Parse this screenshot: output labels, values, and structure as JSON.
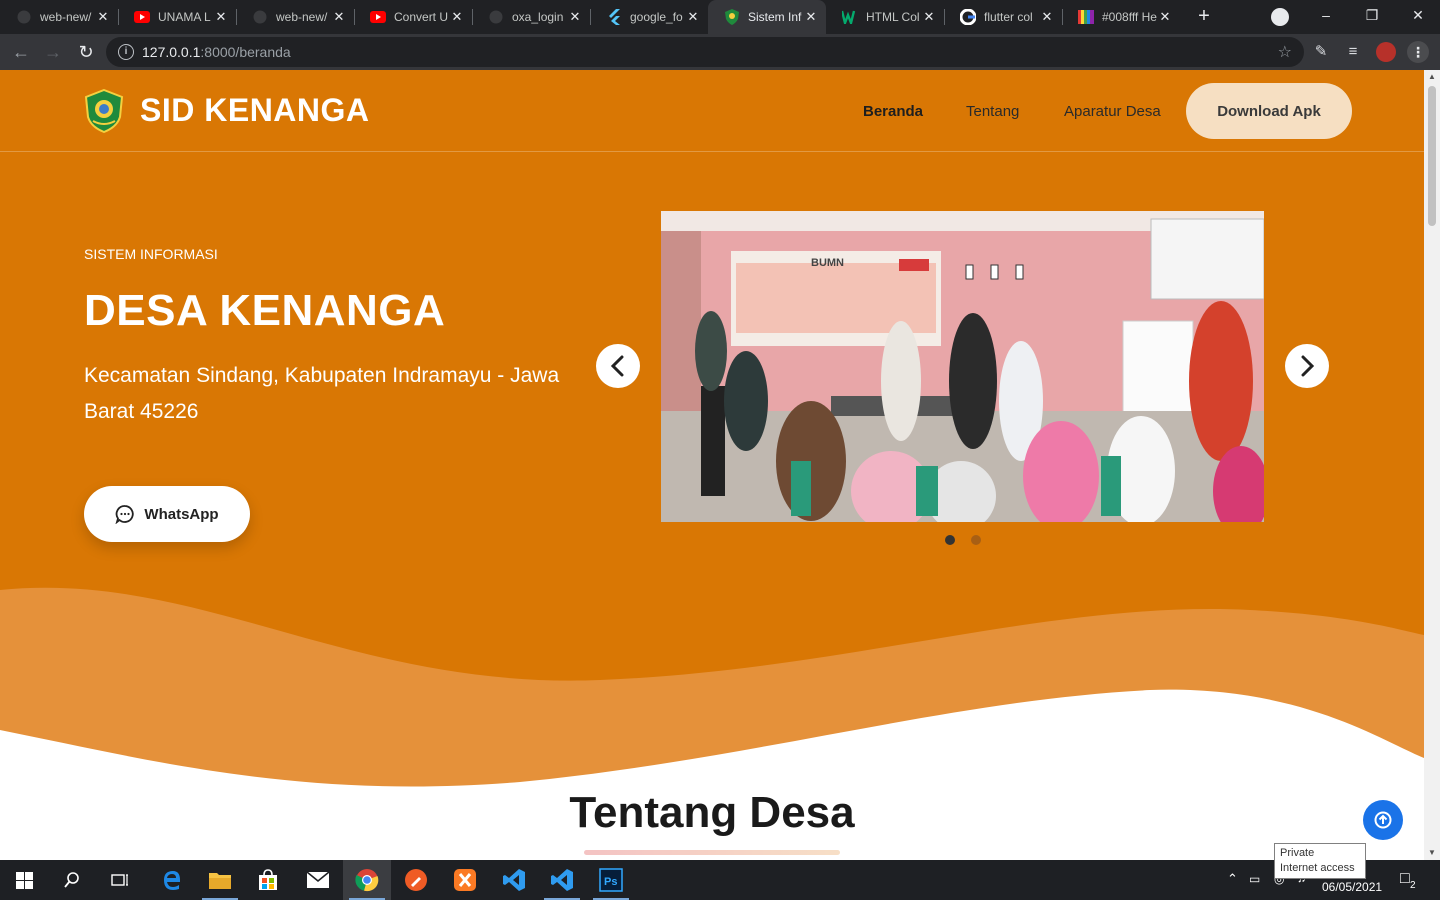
{
  "browser": {
    "tabs": [
      {
        "title": "web-new/",
        "icon": "github-icon"
      },
      {
        "title": "UNAMA L",
        "icon": "youtube-icon"
      },
      {
        "title": "web-new/",
        "icon": "github-icon"
      },
      {
        "title": "Convert U",
        "icon": "youtube-icon"
      },
      {
        "title": "oxa_login",
        "icon": "github-icon"
      },
      {
        "title": "google_fo",
        "icon": "flutter-icon"
      },
      {
        "title": "Sistem Inf",
        "icon": "village-logo-icon",
        "active": true
      },
      {
        "title": "HTML Col",
        "icon": "w3-icon"
      },
      {
        "title": "flutter col",
        "icon": "google-icon"
      },
      {
        "title": "#008fff He",
        "icon": "color-hex-icon"
      }
    ],
    "url_host": "127.0.0.1",
    "url_rest": ":8000/beranda"
  },
  "site": {
    "brand": "SID KENANGA",
    "nav": {
      "home": "Beranda",
      "about": "Tentang",
      "officials": "Aparatur Desa",
      "download": "Download Apk"
    },
    "hero": {
      "eyebrow": "SISTEM INFORMASI",
      "headline": "DESA KENANGA",
      "address": "Kecamatan Sindang, Kabupaten Indramayu - Jawa Barat 45226",
      "whatsapp": "WhatsApp"
    },
    "carousel": {
      "slide_count": 2,
      "active_slide": 1,
      "banner_text": "BUMN"
    },
    "section_title": "Tentang Desa"
  },
  "taskbar": {
    "tooltip_line1": "Private",
    "tooltip_line2": "Internet access",
    "date": "06/05/2021",
    "notification_count": "2"
  },
  "colors": {
    "hero_orange": "#d97704",
    "wave_light": "#e5913a",
    "download_btn": "#f6dfc2",
    "to_top_blue": "#1a73e8"
  }
}
